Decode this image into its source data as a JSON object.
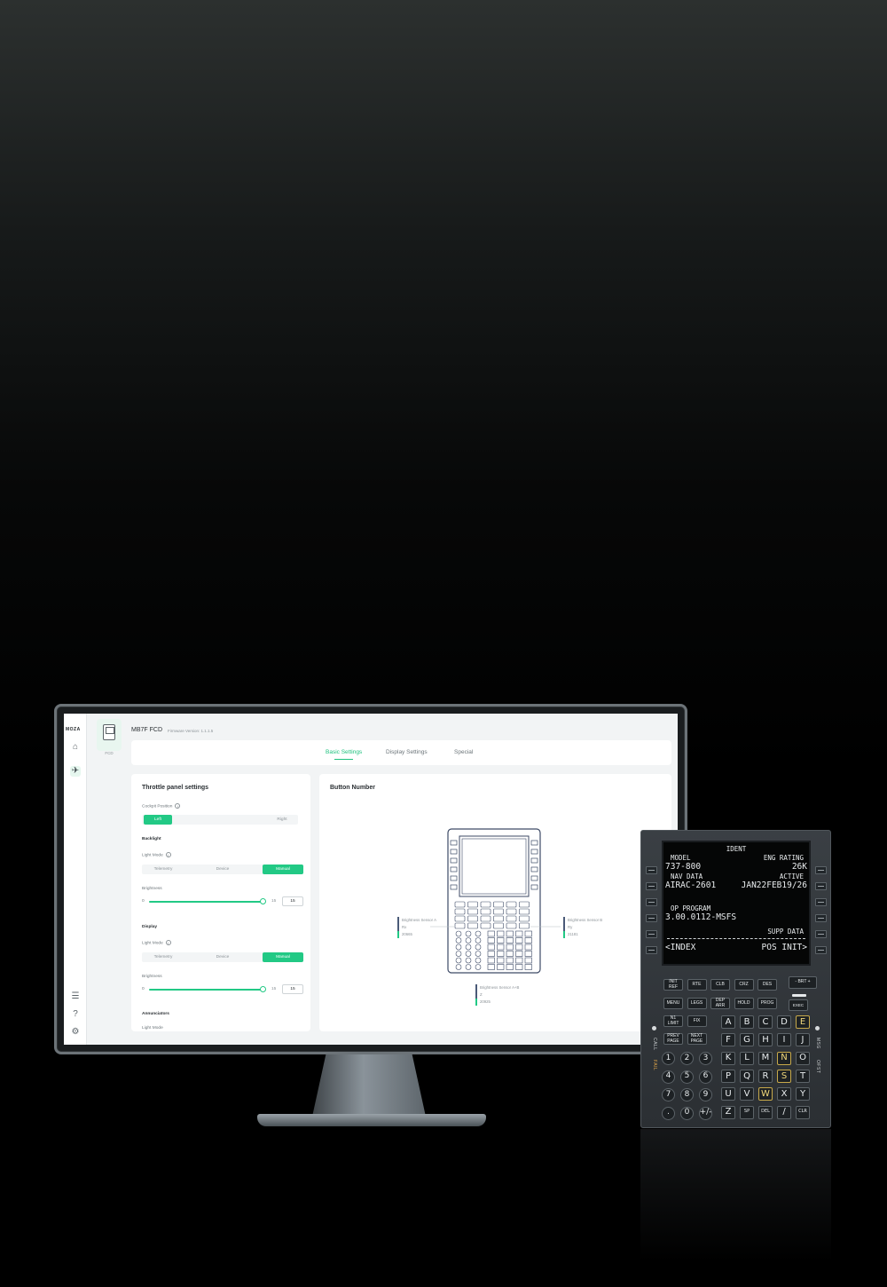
{
  "app": {
    "logo": "MOZA",
    "device_name": "MB7F FCD",
    "device_card_label": "FCD",
    "firmware": "Firmware Version: 1.1.1.5"
  },
  "sidebar": {
    "icons": [
      "home-icon",
      "plane-icon",
      "sliders-icon",
      "help-icon",
      "gear-icon"
    ]
  },
  "tabs": [
    "Basic Settings",
    "Display Settings",
    "Special"
  ],
  "active_tab": "Basic Settings",
  "left_panel": {
    "title": "Throttle panel settings",
    "cockpit_position": {
      "label": "Cockpit Position",
      "options": [
        "Left",
        "Right"
      ],
      "selected": "Left"
    },
    "backlight": {
      "section": "Backlight",
      "light_mode_label": "Light Mode",
      "options": [
        "Telemetry",
        "Device",
        "Manual"
      ],
      "selected": "Manual",
      "brightness_label": "Brightness",
      "min": "0",
      "max": "15",
      "value": "15"
    },
    "display": {
      "section": "Display",
      "light_mode_label": "Light Mode",
      "options": [
        "Telemetry",
        "Device",
        "Manual"
      ],
      "selected": "Manual",
      "brightness_label": "Brightness",
      "min": "0",
      "max": "15",
      "value": "15"
    },
    "annunciators": {
      "section": "Annunciators",
      "light_mode_label": "Light Mode"
    }
  },
  "right_panel": {
    "title": "Button Number",
    "sensors": [
      {
        "name": "Brightness Sensor A",
        "axis": "Rx",
        "value": "20665"
      },
      {
        "name": "Brightness Sensor B",
        "axis": "Ry",
        "value": "21181"
      },
      {
        "name": "Brightness Sensor A+B",
        "axis": "Z",
        "value": "20925"
      }
    ]
  },
  "fmc": {
    "screen_lines": [
      {
        "text": "IDENT",
        "size": "small",
        "align": "center"
      },
      {
        "left": "MODEL",
        "right": "ENG RATING",
        "size": "small"
      },
      {
        "left": "737-800",
        "right": "26K",
        "size": "large"
      },
      {
        "left": "NAV DATA",
        "right": "ACTIVE",
        "size": "small"
      },
      {
        "left": "AIRAC-2601",
        "right": "JAN22FEB19/26",
        "size": "large"
      },
      {
        "left": "OP PROGRAM",
        "right": "",
        "size": "small"
      },
      {
        "left": "3.00.0112-MSFS",
        "right": "",
        "size": "large"
      },
      {
        "left": "",
        "right": "SUPP DATA",
        "size": "small"
      },
      {
        "left": "<INDEX",
        "right": "POS INIT>",
        "size": "large"
      }
    ],
    "func_row1": [
      "INIT REF",
      "RTE",
      "CLB",
      "CRZ",
      "DES"
    ],
    "brt_label": "- BRT +",
    "func_row2": [
      "MENU",
      "LEGS",
      "DEP ARR",
      "HOLD",
      "PROG"
    ],
    "exec_label": "EXEC",
    "func_row3": [
      "N1 LIMIT",
      "FIX"
    ],
    "func_row4": [
      "PREV PAGE",
      "NEXT PAGE"
    ],
    "numpad": [
      "1",
      "2",
      "3",
      "4",
      "5",
      "6",
      "7",
      "8",
      "9",
      ".",
      "0",
      "+/-"
    ],
    "alpha_rows": [
      [
        "A",
        "B",
        "C",
        "D",
        "E"
      ],
      [
        "F",
        "G",
        "H",
        "I",
        "J"
      ],
      [
        "K",
        "L",
        "M",
        "N",
        "O"
      ],
      [
        "P",
        "Q",
        "R",
        "S",
        "T"
      ],
      [
        "U",
        "V",
        "W",
        "X",
        "Y"
      ],
      [
        "Z",
        "SP",
        "DEL",
        "/",
        "CLR"
      ]
    ],
    "lit_keys": [
      "E",
      "N",
      "S",
      "W"
    ],
    "left_annunciators": [
      "CALL",
      "FAIL"
    ],
    "right_annunciators": [
      "MSG",
      "OFST"
    ]
  }
}
